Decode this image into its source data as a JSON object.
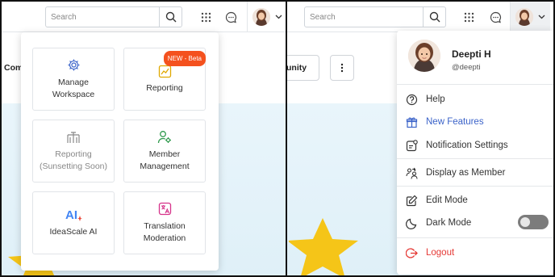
{
  "left_panel": {
    "search": {
      "placeholder": "Search"
    },
    "behind_tab_label": "Com",
    "apps_menu": {
      "tiles": [
        {
          "label_line1": "Manage",
          "label_line2": "Workspace",
          "icon": "gear-icon",
          "muted": false
        },
        {
          "label_line1": "Reporting",
          "label_line2": "",
          "icon": "chart-icon",
          "badge": "NEW - Beta",
          "muted": false
        },
        {
          "label_line1": "Reporting",
          "label_line2": "(Sunsetting Soon)",
          "icon": "report-icon",
          "muted": true
        },
        {
          "label_line1": "Member",
          "label_line2": "Management",
          "icon": "member-gear-icon",
          "muted": false
        },
        {
          "label_line1": "IdeaScale AI",
          "label_line2": "",
          "icon": "ai-icon",
          "muted": false
        },
        {
          "label_line1": "Translation",
          "label_line2": "Moderation",
          "icon": "translate-icon",
          "muted": false
        }
      ]
    }
  },
  "right_panel": {
    "search": {
      "placeholder": "Search"
    },
    "behind_tab_label": "unity",
    "profile_menu": {
      "name": "Deepti H",
      "handle": "@deepti",
      "items": [
        {
          "label": "Help",
          "icon": "help-circle-icon"
        },
        {
          "label": "New Features",
          "icon": "gift-icon"
        },
        {
          "label": "Notification Settings",
          "icon": "notification-settings-icon"
        },
        {
          "label": "Display as Member",
          "icon": "display-member-icon"
        },
        {
          "label": "Edit Mode",
          "icon": "edit-icon"
        },
        {
          "label": "Dark Mode",
          "icon": "moon-icon",
          "toggle": false
        },
        {
          "label": "Logout",
          "icon": "logout-icon"
        }
      ]
    }
  },
  "colors": {
    "accent_blue": "#3b63c9",
    "logout_red": "#e53935",
    "beta_badge": "#f4511e",
    "hero_bg": "#e6f3fa",
    "star": "#f5c518"
  }
}
